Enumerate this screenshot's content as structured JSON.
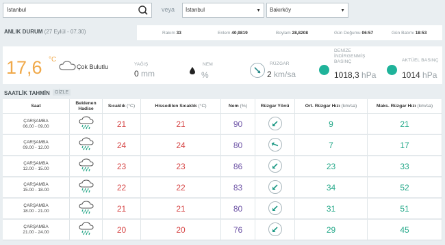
{
  "search": {
    "value": "İstanbul",
    "placeholder": ""
  },
  "veya_label": "veya",
  "select_province": {
    "value": "İstanbul"
  },
  "select_district": {
    "value": "Bakırköy"
  },
  "anlik": {
    "title": "ANLIK DURUM",
    "date": "(27 Eylül - 07.30)",
    "rakim_label": "Rakım",
    "rakim": "33",
    "enlem_label": "Enlem",
    "enlem": "40,9819",
    "boylam_label": "Boylam",
    "boylam": "28,8208",
    "gundogumu_label": "Gün Doğumu",
    "gundogumu": "06:57",
    "gunbatimi_label": "Gün Batımı",
    "gunbatimi": "18:53"
  },
  "current": {
    "temp": "17,6",
    "unit": "°C",
    "condition": "Çok Bulutlu",
    "rain_label": "YAĞIŞ",
    "rain_value": "0",
    "rain_unit": "mm",
    "humidity_label": "NEM",
    "humidity_unit": "%",
    "wind_label": "RÜZGAR",
    "wind_value": "2",
    "wind_unit": "km/sa",
    "sea_pressure_label": "DENİZE İNDİRGENMİŞ BASINÇ",
    "sea_pressure_value": "1018,3",
    "sea_pressure_unit": "hPa",
    "actual_pressure_label": "AKTÜEL BASINÇ",
    "actual_pressure_value": "1014",
    "actual_pressure_unit": "hPa",
    "accent_color": "#f0a94a",
    "pressure_color": "#1fb39a"
  },
  "hourly": {
    "title": "SAATLİK TAHMİN",
    "hide_label": "GİZLE",
    "headers": {
      "saat": "Saat",
      "hadise": "Beklenen Hadise",
      "sicaklik": "Sıcaklık",
      "sicaklik_unit": "(°C)",
      "hissedilen": "Hissedilen Sıcaklık",
      "hissedilen_unit": "(°C)",
      "nem": "Nem",
      "nem_unit": "(%)",
      "ruzgar_yonu": "Rüzgar Yönü",
      "ort_ruzgar": "Ort. Rüzgar Hızı",
      "ort_ruzgar_unit": "(km/sa)",
      "maks_ruzgar": "Maks. Rüzgar Hızı",
      "maks_ruzgar_unit": "(km/sa)"
    },
    "rows": [
      {
        "day": "ÇARŞAMBA",
        "time": "06.00 - 09.00",
        "icon": "rain-cloud-icon",
        "temp": "21",
        "feels": "21",
        "hum": "90",
        "dir": 225,
        "avg": "9",
        "max": "21"
      },
      {
        "day": "ÇARŞAMBA",
        "time": "09.00 - 12.00",
        "icon": "rain-cloud-icon",
        "temp": "24",
        "feels": "24",
        "hum": "80",
        "dir": 290,
        "avg": "7",
        "max": "17"
      },
      {
        "day": "ÇARŞAMBA",
        "time": "12.00 - 15.00",
        "icon": "rain-cloud-icon",
        "temp": "23",
        "feels": "23",
        "hum": "86",
        "dir": 225,
        "avg": "23",
        "max": "33"
      },
      {
        "day": "ÇARŞAMBA",
        "time": "15.00 - 18.00",
        "icon": "rain-cloud-icon",
        "temp": "22",
        "feels": "22",
        "hum": "83",
        "dir": 225,
        "avg": "34",
        "max": "52"
      },
      {
        "day": "ÇARŞAMBA",
        "time": "18.00 - 21.00",
        "icon": "rain-cloud-icon",
        "temp": "21",
        "feels": "21",
        "hum": "80",
        "dir": 225,
        "avg": "31",
        "max": "51"
      },
      {
        "day": "ÇARŞAMBA",
        "time": "21.00 - 24.00",
        "icon": "rain-cloud-icon",
        "temp": "20",
        "feels": "20",
        "hum": "76",
        "dir": 225,
        "avg": "29",
        "max": "45"
      }
    ]
  }
}
